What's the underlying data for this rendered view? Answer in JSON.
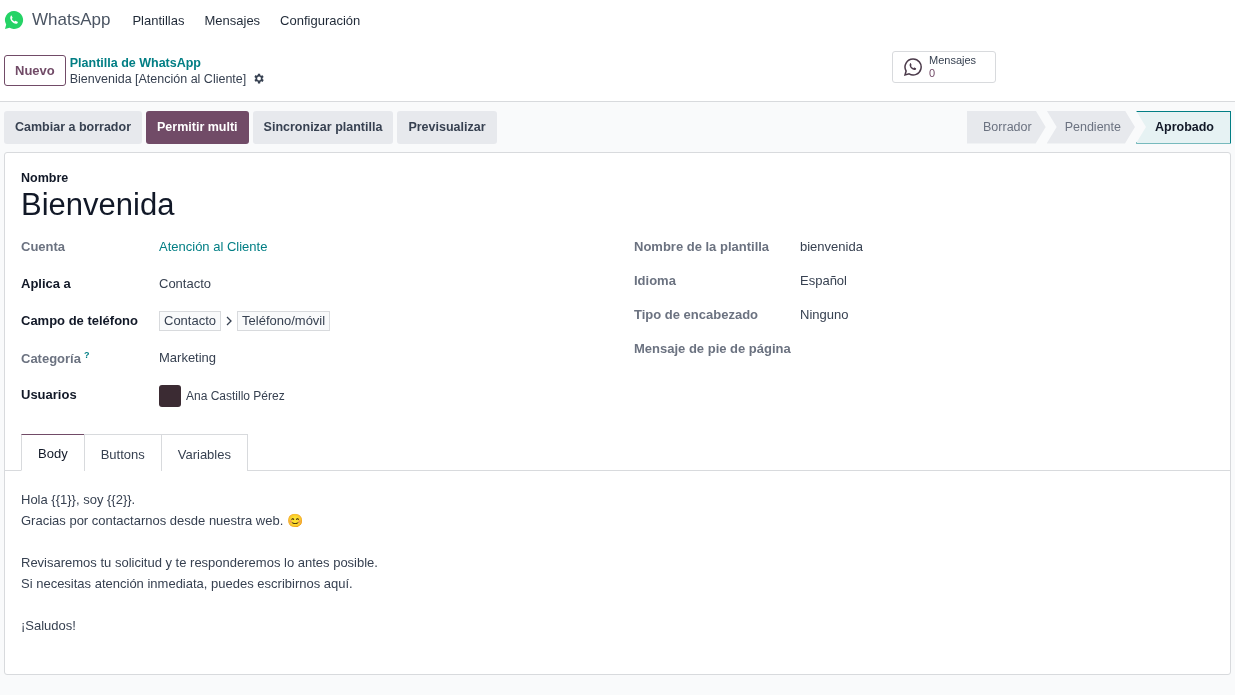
{
  "navbar": {
    "app": "WhatsApp",
    "menus": [
      "Plantillas",
      "Mensajes",
      "Configuración"
    ]
  },
  "control_panel": {
    "new_button": "Nuevo",
    "breadcrumb": "Plantilla de WhatsApp",
    "record": "Bienvenida [Atención al Cliente]",
    "smart_button": {
      "label": "Mensajes",
      "count": "0"
    }
  },
  "actions": [
    {
      "label": "Cambiar a borrador",
      "kind": "secondary"
    },
    {
      "label": "Permitir multi",
      "kind": "primary"
    },
    {
      "label": "Sincronizar plantilla",
      "kind": "secondary"
    },
    {
      "label": "Previsualizar",
      "kind": "secondary"
    }
  ],
  "statusbar": [
    {
      "label": "Borrador",
      "selected": false
    },
    {
      "label": "Pendiente",
      "selected": false
    },
    {
      "label": "Aprobado",
      "selected": true
    }
  ],
  "form": {
    "name_label": "Nombre",
    "name": "Bienvenida",
    "left_fields": [
      {
        "label": "Cuenta",
        "required": false,
        "kind": "link",
        "value": "Atención al Cliente"
      },
      {
        "label": "Aplica a",
        "required": true,
        "kind": "text",
        "value": "Contacto"
      },
      {
        "label": "Campo de teléfono",
        "required": true,
        "kind": "path",
        "path": [
          "Contacto",
          "Teléfono/móvil"
        ]
      },
      {
        "label": "Categoría",
        "required": false,
        "help": "?",
        "kind": "text",
        "value": "Marketing"
      },
      {
        "label": "Usuarios",
        "required": true,
        "kind": "user",
        "value": "Ana Castillo Pérez"
      }
    ],
    "right_fields": [
      {
        "label": "Nombre de la plantilla",
        "required": false,
        "kind": "text",
        "value": "bienvenida"
      },
      {
        "label": "Idioma",
        "required": false,
        "kind": "text",
        "value": "Español"
      },
      {
        "label": "Tipo de encabezado",
        "required": false,
        "kind": "text",
        "value": "Ninguno"
      },
      {
        "label": "Mensaje de pie de página",
        "required": false,
        "kind": "empty"
      }
    ]
  },
  "tabs": [
    {
      "label": "Body",
      "selected": true
    },
    {
      "label": "Buttons",
      "selected": false
    },
    {
      "label": "Variables",
      "selected": false
    }
  ],
  "body": [
    [
      "Hola {{1}}, soy {{2}}.",
      "Gracias por contactarnos desde nuestra web. 😊"
    ],
    [
      "Revisaremos tu solicitud y te responderemos lo antes posible.",
      "Si necesitas atención inmediata, puedes escribirnos aquí."
    ],
    [
      "¡Saludos!"
    ]
  ]
}
